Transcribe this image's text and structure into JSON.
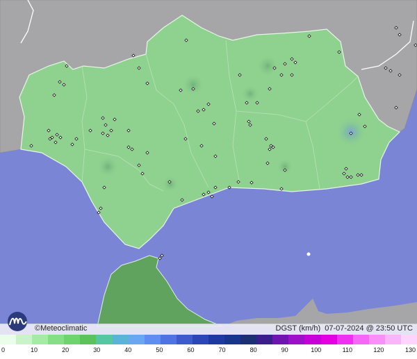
{
  "map": {
    "brand": "©Meteoclimatic",
    "caption_parameter": "DGST (km/h)",
    "caption_datetime": "07-07-2024 @ 23:50 UTC",
    "colors": {
      "sea": "#7b85d6",
      "land_outside": "#a6a6a8",
      "land_region": "#8fd18f",
      "morocco": "#5fa35f",
      "border": "#ffffff"
    }
  },
  "legend": {
    "ticks": [
      "0",
      "10",
      "20",
      "30",
      "40",
      "50",
      "60",
      "70",
      "80",
      "90",
      "100",
      "110",
      "120",
      "130"
    ],
    "colors": [
      "#eaffea",
      "#c8f4c8",
      "#a4eba4",
      "#86df86",
      "#6fd46f",
      "#5cc35c",
      "#56c7a0",
      "#5bb4d8",
      "#6aa7f0",
      "#5d8ef0",
      "#4d74e0",
      "#3c5ccc",
      "#2a47b5",
      "#1e3aa0",
      "#17358a",
      "#1a2f74",
      "#3b1e8c",
      "#6e15b0",
      "#9c10c8",
      "#c800d8",
      "#e400e0",
      "#f030f0",
      "#f568f5",
      "#f890f8",
      "#fab4fa",
      "#fcd4fc"
    ]
  }
}
